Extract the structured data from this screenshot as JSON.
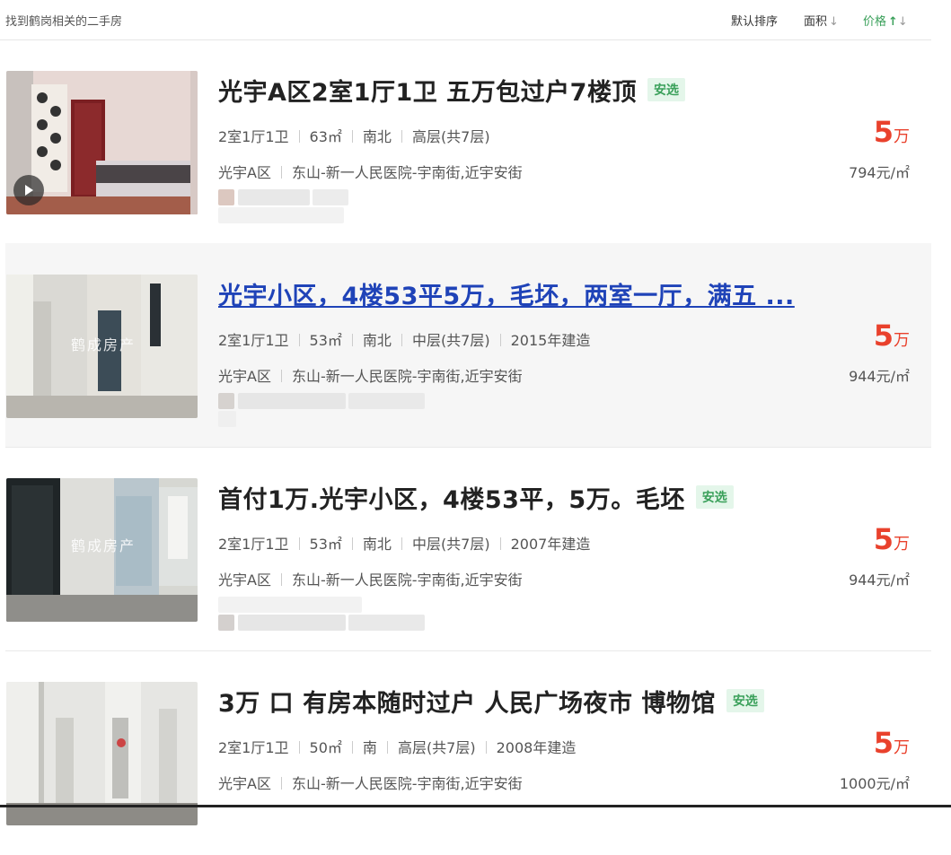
{
  "header": {
    "found_text": "找到鹤岗相关的二手房",
    "sort_default": "默认排序",
    "sort_area": "面积",
    "sort_price": "价格"
  },
  "colors": {
    "accent": "#3aa05a",
    "price": "#e9412c",
    "link": "#1f43b8"
  },
  "listings": [
    {
      "title": "光宇A区2室1厅1卫 五万包过户7楼顶",
      "badge": "安选",
      "meta": [
        "2室1厅1卫",
        "63㎡",
        "南北",
        "高层(共7层)"
      ],
      "community": "光宇A区",
      "address": "东山-新一人民医院-宇南街,近宇安街",
      "price_num": "5",
      "price_unit": "万",
      "unit_price": "794元/㎡"
    },
    {
      "title": "光宇小区，4楼53平5万，毛坯，两室一厅，满五 ...",
      "badge": "",
      "meta": [
        "2室1厅1卫",
        "53㎡",
        "南北",
        "中层(共7层)",
        "2015年建造"
      ],
      "community": "光宇A区",
      "address": "东山-新一人民医院-宇南街,近宇安街",
      "price_num": "5",
      "price_unit": "万",
      "unit_price": "944元/㎡",
      "watermark": "鹤成房产"
    },
    {
      "title": "首付1万.光宇小区，4楼53平，5万。毛坯",
      "badge": "安选",
      "meta": [
        "2室1厅1卫",
        "53㎡",
        "南北",
        "中层(共7层)",
        "2007年建造"
      ],
      "community": "光宇A区",
      "address": "东山-新一人民医院-宇南街,近宇安街",
      "price_num": "5",
      "price_unit": "万",
      "unit_price": "944元/㎡",
      "watermark": "鹤成房产"
    },
    {
      "title": "3万 口 有房本随时过户 人民广场夜市 博物馆",
      "badge": "安选",
      "meta": [
        "2室1厅1卫",
        "50㎡",
        "南",
        "高层(共7层)",
        "2008年建造"
      ],
      "community": "光宇A区",
      "address": "东山-新一人民医院-宇南街,近宇安街",
      "price_num": "5",
      "price_unit": "万",
      "unit_price": "1000元/㎡"
    }
  ]
}
